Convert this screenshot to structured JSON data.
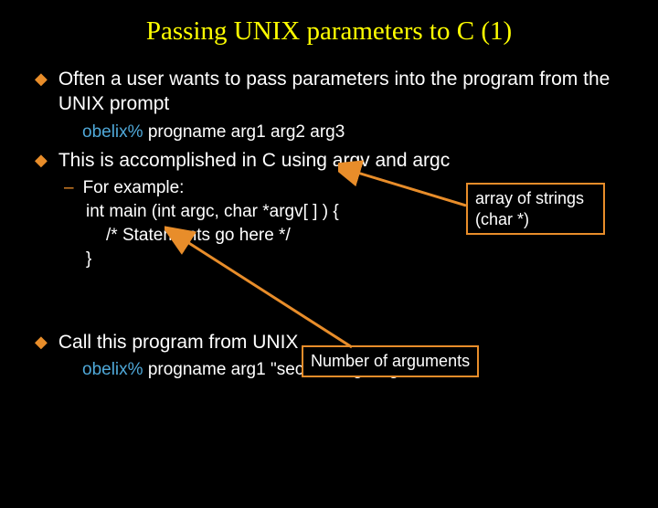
{
  "title": "Passing UNIX parameters to C (1)",
  "b1": "Often a user wants to pass parameters into the program from the UNIX prompt",
  "prompt1": "obelix%",
  "cmd1": " progname arg1 arg2 arg3",
  "b2": "This is accomplished in C using argv and argc",
  "example_label": "For example:",
  "code1": "int main (int argc, char *argv[ ] ) {",
  "code2": "/*  Statements go here */",
  "code3": "}",
  "b3": "Call this program from UNIX",
  "prompt2": "obelix%",
  "cmd2": " progname arg1  \"second arg\"  arg3",
  "callout1_l1": "array of strings",
  "callout1_l2": "(char *)",
  "callout2": "Number of arguments"
}
